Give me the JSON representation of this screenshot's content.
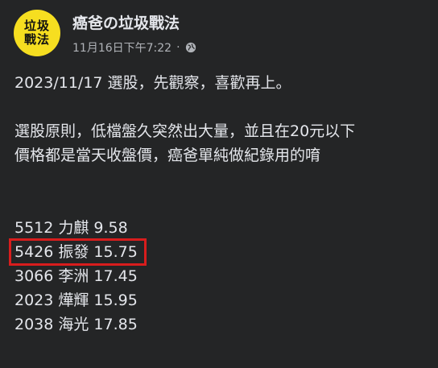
{
  "page": {
    "avatar_text": "垃圾戰法",
    "name": "癌爸の垃圾戰法",
    "timestamp": "11月16日下午7:22",
    "separator": "·",
    "privacy_icon": "globe-icon"
  },
  "post": {
    "line1": "2023/11/17 選股，先觀察，喜歡再上。",
    "line2": "選股原則，低檔盤久突然出大量，並且在20元以下",
    "line3": "價格都是當天收盤價，癌爸單純做紀錄用的唷",
    "stocks": [
      {
        "text": "5512 力麒 9.58",
        "highlighted": false
      },
      {
        "text": "5426 振發 15.75",
        "highlighted": true
      },
      {
        "text": "3066 李洲 17.45",
        "highlighted": false
      },
      {
        "text": "2023 燁輝 15.95",
        "highlighted": false
      },
      {
        "text": "2038 海光 17.85",
        "highlighted": false
      }
    ]
  },
  "colors": {
    "background": "#242526",
    "text": "#e4e6eb",
    "muted": "#b0b3b8",
    "avatar_bg": "#f6de20",
    "highlight_border": "#d81d1d"
  }
}
